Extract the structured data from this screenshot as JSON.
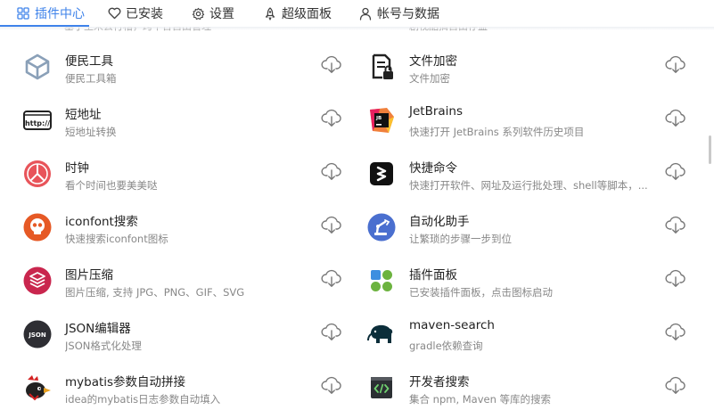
{
  "tabs": [
    {
      "label": "插件中心",
      "icon": "grid-icon",
      "active": true
    },
    {
      "label": "已安装",
      "icon": "heart-icon"
    },
    {
      "label": "设置",
      "icon": "gear-icon"
    },
    {
      "label": "超级面板",
      "icon": "rocket-icon"
    },
    {
      "label": "帐号与数据",
      "icon": "user-icon"
    }
  ],
  "cutoff": {
    "left": "基于主来去行槽，跨平台自由管理",
    "right": "剧视酷搞自由存益"
  },
  "plugins_left": [
    {
      "title": "便民工具",
      "desc": "便民工具箱",
      "icon": "cube-icon"
    },
    {
      "title": "短地址",
      "desc": "短地址转换",
      "icon": "http-icon"
    },
    {
      "title": "时钟",
      "desc": "看个时间也要美美哒",
      "icon": "clock-icon"
    },
    {
      "title": "iconfont搜索",
      "desc": "快速搜索iconfont图标",
      "icon": "iconfont-icon"
    },
    {
      "title": "图片压缩",
      "desc": "图片压缩, 支持 JPG、PNG、GIF、SVG",
      "icon": "image-compress-icon"
    },
    {
      "title": "JSON编辑器",
      "desc": "JSON格式化处理",
      "icon": "json-icon"
    },
    {
      "title": "mybatis参数自动拼接",
      "desc": "idea的mybatis日志参数自动填入",
      "icon": "mybatis-bird-icon"
    }
  ],
  "plugins_right": [
    {
      "title": "文件加密",
      "desc": "文件加密",
      "icon": "file-lock-icon"
    },
    {
      "title": "JetBrains",
      "desc": "快速打开 JetBrains 系列软件历史项目",
      "icon": "jetbrains-icon"
    },
    {
      "title": "快捷命令",
      "desc": "快速打开软件、网址及运行批处理、shell等脚本，...",
      "icon": "shortcut-icon"
    },
    {
      "title": "自动化助手",
      "desc": "让繁琐的步骤一步到位",
      "icon": "robot-arm-icon"
    },
    {
      "title": "插件面板",
      "desc": "已安装插件面板，点击图标启动",
      "icon": "panel-grid-icon"
    },
    {
      "title": "maven-search",
      "desc": "gradle依赖查询",
      "icon": "maven-elephant-icon"
    },
    {
      "title": "开发者搜索",
      "desc": "集合 npm, Maven 等库的搜索",
      "icon": "code-search-icon"
    }
  ],
  "download_icon": "cloud-download-icon",
  "colors": {
    "accent": "#3f83ea",
    "text": "#222222",
    "subtext": "#888888"
  }
}
